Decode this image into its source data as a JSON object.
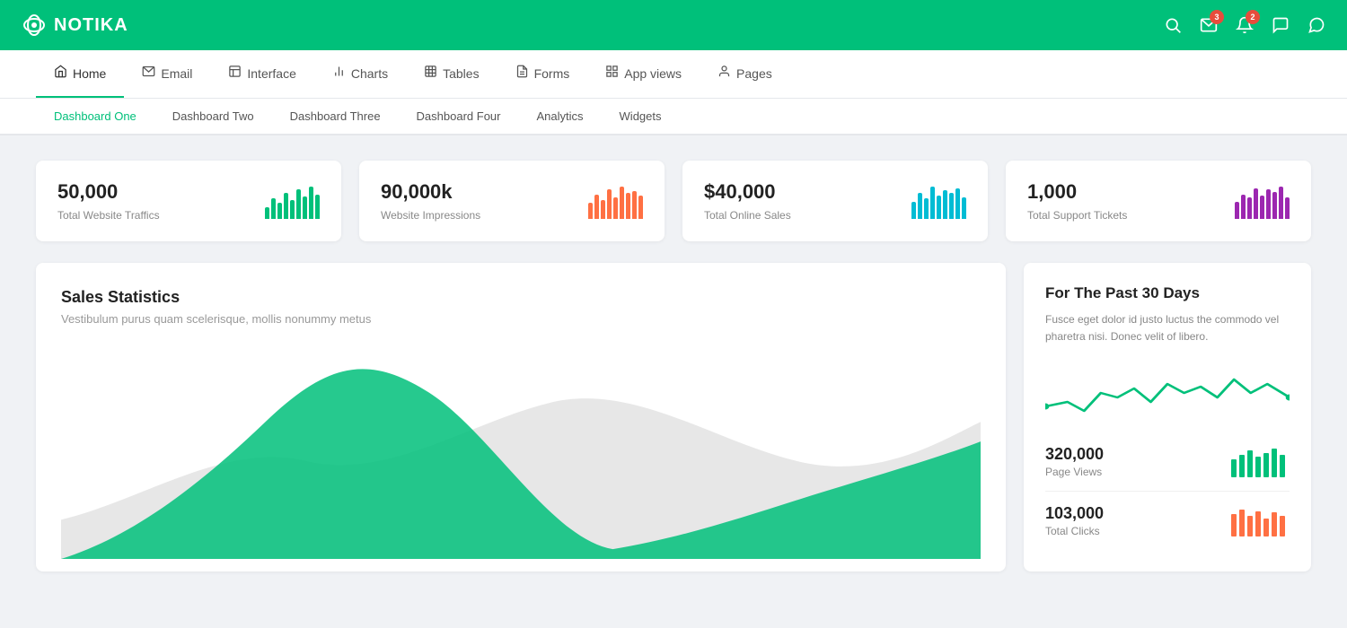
{
  "brand": {
    "name": "NOTIKA",
    "logo_alt": "notika-logo"
  },
  "topbar": {
    "icons": [
      {
        "name": "search-icon",
        "symbol": "🔍",
        "badge": null
      },
      {
        "name": "email-icon",
        "symbol": "✉",
        "badge": "3"
      },
      {
        "name": "bell-icon",
        "symbol": "🔔",
        "badge": "2"
      },
      {
        "name": "chat-icon",
        "symbol": "💬",
        "badge": null
      },
      {
        "name": "message-icon",
        "symbol": "📨",
        "badge": null
      }
    ]
  },
  "navbar": {
    "tabs": [
      {
        "label": "Home",
        "icon": "🏠",
        "active": true
      },
      {
        "label": "Email",
        "icon": "✉",
        "active": false
      },
      {
        "label": "Interface",
        "icon": "📋",
        "active": false
      },
      {
        "label": "Charts",
        "icon": "📊",
        "active": false
      },
      {
        "label": "Tables",
        "icon": "📄",
        "active": false
      },
      {
        "label": "Forms",
        "icon": "📝",
        "active": false
      },
      {
        "label": "App views",
        "icon": "⊞",
        "active": false
      },
      {
        "label": "Pages",
        "icon": "👤",
        "active": false
      }
    ]
  },
  "subnav": {
    "items": [
      {
        "label": "Dashboard One",
        "active": true
      },
      {
        "label": "Dashboard Two",
        "active": false
      },
      {
        "label": "Dashboard Three",
        "active": false
      },
      {
        "label": "Dashboard Four",
        "active": false
      },
      {
        "label": "Analytics",
        "active": false
      },
      {
        "label": "Widgets",
        "active": false
      }
    ]
  },
  "stats": [
    {
      "value": "50,000",
      "label": "Total Website Traffics",
      "color": "#00c07a",
      "bars": [
        20,
        35,
        28,
        45,
        32,
        50,
        38,
        55,
        42
      ]
    },
    {
      "value": "90,000k",
      "label": "Website Impressions",
      "color": "#ff7043",
      "bars": [
        30,
        45,
        35,
        55,
        40,
        60,
        48,
        52,
        44
      ]
    },
    {
      "value": "$40,000",
      "label": "Total Online Sales",
      "color": "#00bcd4",
      "bars": [
        25,
        38,
        30,
        48,
        35,
        42,
        38,
        45,
        32
      ]
    },
    {
      "value": "1,000",
      "label": "Total Support Tickets",
      "color": "#9c27b0",
      "bars": [
        22,
        32,
        28,
        40,
        30,
        38,
        35,
        42,
        28
      ]
    }
  ],
  "sales_card": {
    "title": "Sales Statistics",
    "subtitle": "Vestibulum purus quam scelerisque, mollis nonummy metus"
  },
  "side_card": {
    "title": "For The Past 30 Days",
    "desc": "Fusce eget dolor id justo luctus the commodo vel pharetra nisi. Donec velit of libero.",
    "stats": [
      {
        "value": "320,000",
        "label": "Page Views",
        "color": "#00c07a"
      },
      {
        "value": "103,000",
        "label": "Total Clicks",
        "color": "#ff7043"
      }
    ]
  }
}
